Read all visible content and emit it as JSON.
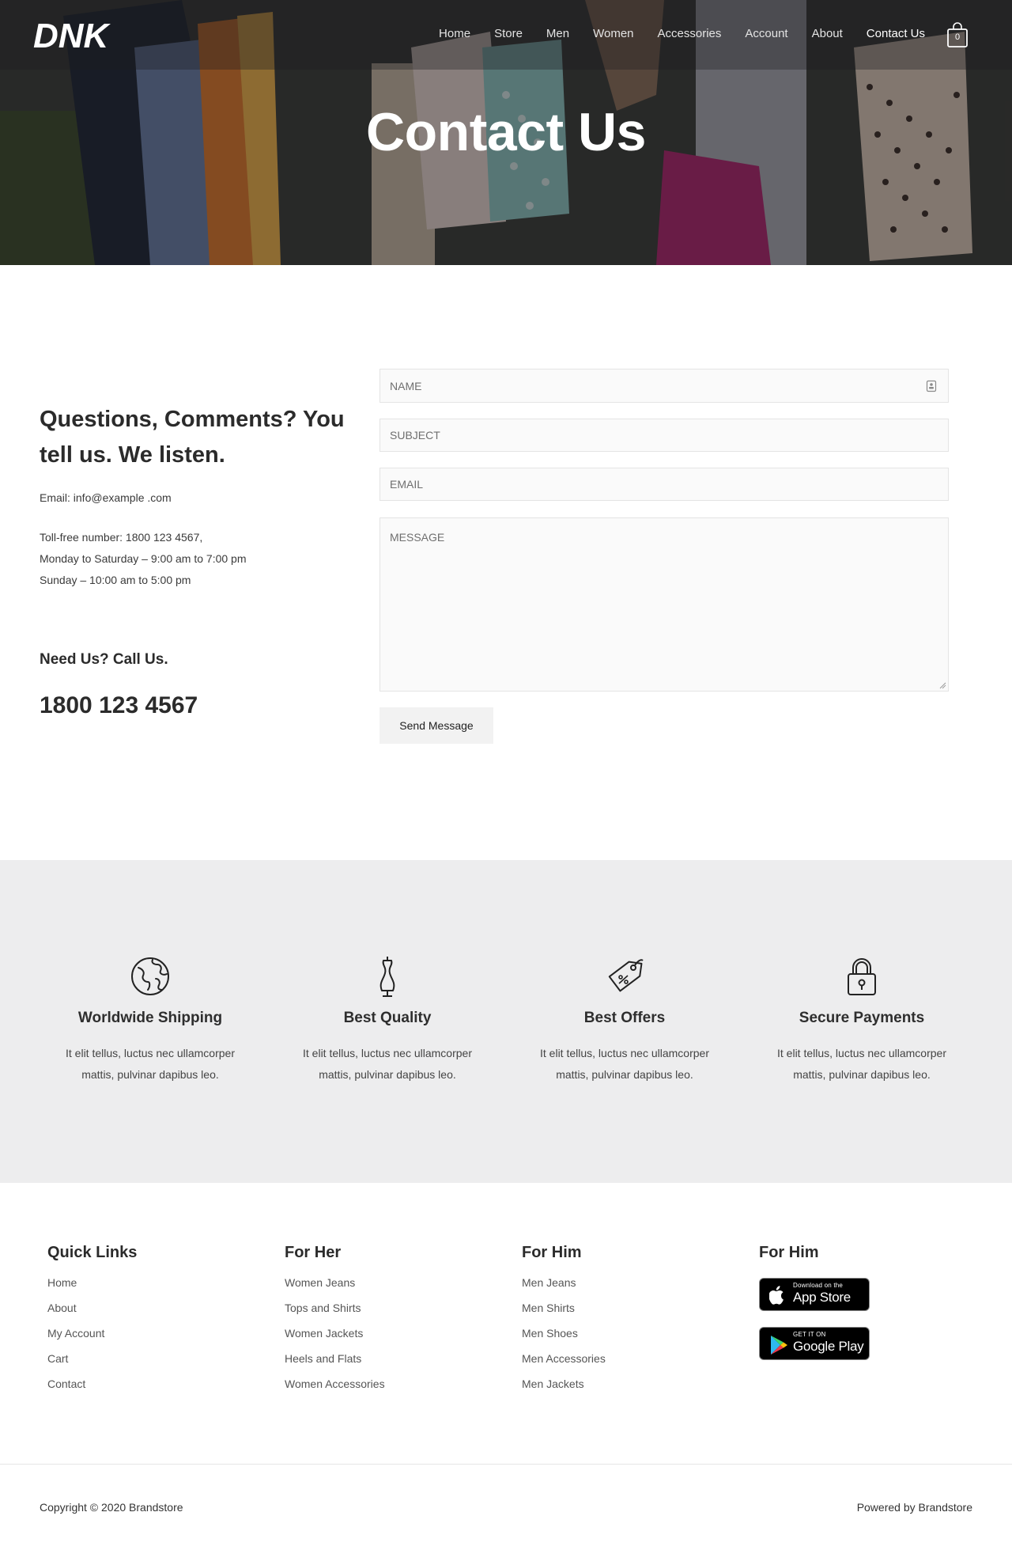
{
  "brand": {
    "logo_text": "DNK"
  },
  "nav": {
    "items": [
      {
        "label": "Home"
      },
      {
        "label": "Store"
      },
      {
        "label": "Men"
      },
      {
        "label": "Women"
      },
      {
        "label": "Accessories"
      },
      {
        "label": "Account"
      },
      {
        "label": "About"
      },
      {
        "label": "Contact Us"
      }
    ],
    "active": "Contact Us",
    "cart_count": "0"
  },
  "hero": {
    "title": "Contact Us"
  },
  "contact": {
    "heading": "Questions, Comments? You tell us. We listen.",
    "email_line": "Email: info@example .com",
    "tollfree_line": "Toll-free number: 1800 123 4567,",
    "weekday_hours": "Monday to Saturday – 9:00 am to 7:00 pm",
    "sunday_hours": "Sunday – 10:00 am to 5:00 pm",
    "call_label": "Need Us? Call Us.",
    "call_number": "1800 123 4567"
  },
  "form": {
    "name_placeholder": "NAME",
    "subject_placeholder": "SUBJECT",
    "email_placeholder": "EMAIL",
    "message_placeholder": "MESSAGE",
    "submit_label": "Send Message"
  },
  "features": [
    {
      "icon": "globe-icon",
      "title": "Worldwide Shipping",
      "line1": "It elit tellus, luctus nec ullamcorper",
      "line2": "mattis, pulvinar dapibus leo."
    },
    {
      "icon": "mannequin-icon",
      "title": "Best Quality",
      "line1": "It elit tellus, luctus nec ullamcorper",
      "line2": "mattis, pulvinar dapibus leo."
    },
    {
      "icon": "price-tag-icon",
      "title": "Best Offers",
      "line1": "It elit tellus, luctus nec ullamcorper",
      "line2": "mattis, pulvinar dapibus leo."
    },
    {
      "icon": "padlock-icon",
      "title": "Secure Payments",
      "line1": "It elit tellus, luctus nec ullamcorper",
      "line2": "mattis, pulvinar dapibus leo."
    }
  ],
  "footer": {
    "quick_links": {
      "heading": "Quick Links",
      "items": [
        "Home",
        "About",
        "My Account",
        "Cart",
        "Contact"
      ]
    },
    "for_her": {
      "heading": "For Her",
      "items": [
        "Women Jeans",
        "Tops and Shirts",
        "Women Jackets",
        "Heels and Flats",
        "Women Accessories"
      ]
    },
    "for_him": {
      "heading": "For Him",
      "items": [
        "Men Jeans",
        "Men Shirts",
        "Men Shoes",
        "Men Accessories",
        "Men Jackets"
      ]
    },
    "apps": {
      "heading": "For Him",
      "app_store": {
        "small": "Download on the",
        "big": "App Store"
      },
      "google_play": {
        "small": "GET IT ON",
        "big": "Google Play"
      }
    },
    "copyright": "Copyright © 2020 Brandstore",
    "powered_by": "Powered by Brandstore"
  },
  "colors": {
    "features_bg": "#ededee",
    "input_bg": "#fafafa",
    "button_bg": "#f2f2f2",
    "text_dark": "#2b2b2b"
  }
}
